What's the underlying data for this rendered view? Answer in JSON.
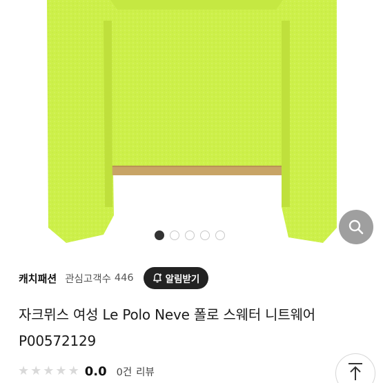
{
  "product": {
    "image_icon": "sweater-photo",
    "image_colors": {
      "sweater": "#cdf04a",
      "trim": "#c8a466"
    },
    "title": "자크뮈스 여성 Le Polo Neve 폴로 스웨터 니트웨어 P00572129"
  },
  "gallery": {
    "page_count": 5,
    "current_page": 1,
    "zoom_icon": "search-icon"
  },
  "seller": {
    "name": "캐치패션",
    "follower_label": "관심고객수",
    "follower_count": "446",
    "alarm_button_label": "알림받기",
    "alarm_icon": "bell-plus-icon"
  },
  "rating": {
    "stars_filled": 0,
    "stars_total": 5,
    "score": "0.0",
    "review_count": "0건",
    "review_suffix": "리뷰"
  },
  "scroll_top_icon": "arrow-up-icon"
}
